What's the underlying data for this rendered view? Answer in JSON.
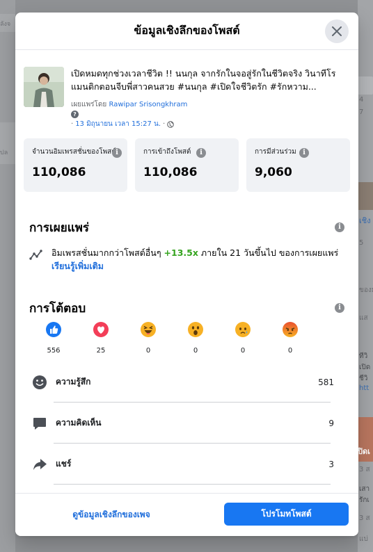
{
  "background": {
    "left_texts": [
      "ลังจ",
      "ปล"
    ],
    "right_texts": [
      "4",
      "7",
      "เชิง",
      "5",
      "ของม",
      "แส",
      "ทีวิ",
      "เปิด",
      "ชีวิ",
      "htt",
      "ปิดเ",
      "3 ส",
      "เสา",
      "รักเ",
      "3 ส",
      "แบ่"
    ]
  },
  "modal": {
    "title": "ข้อมูลเชิงลึกของโพสต์",
    "close_label": "ปิด"
  },
  "post": {
    "text": "เปิดหมดทุกช่วงเวลาชีวิต !! นนกุล จากรักในจอสู่รักในชีวิตจริง วินาทีโรแมนติกตอนจีบพี่สาวคนสวย #นนกุล #เปิดใจชีวิตรัก #รักหวาม...",
    "published_by_prefix": "เผยแพร่โดย",
    "author": "Rawipar Srisongkhram",
    "date": "13 มิถุนายน เวลา 15:27 น."
  },
  "stats": [
    {
      "label": "จำนวนอิมเพรสชั่นของโพสต์",
      "value": "110,086"
    },
    {
      "label": "การเข้าถึงโพสต์",
      "value": "110,086"
    },
    {
      "label": "การมีส่วนร่วม",
      "value": "9,060"
    }
  ],
  "distribution": {
    "title": "การเผยแพร่",
    "text_before": "อิมเพรสชั่นมากกว่าโพสต์อื่นๆ",
    "highlight": "+13.5x",
    "text_after": "ภายใน 21 วันขึ้นไป ของการเผยแพร่",
    "learn_more": "เรียนรู้เพิ่มเติม"
  },
  "responses": {
    "title": "การโต้ตอบ",
    "reactions": [
      {
        "name": "like",
        "count": "556",
        "color": "#1877f2"
      },
      {
        "name": "love",
        "count": "25",
        "color": "#f33e58"
      },
      {
        "name": "haha",
        "count": "0",
        "color": "#f7b125"
      },
      {
        "name": "wow",
        "count": "0",
        "color": "#f7b125"
      },
      {
        "name": "sad",
        "count": "0",
        "color": "#f7b125"
      },
      {
        "name": "angry",
        "count": "0",
        "color": "#e9710f"
      }
    ],
    "metrics": [
      {
        "label": "ความรู้สึก",
        "value": "581",
        "icon": "smiley-icon"
      },
      {
        "label": "ความคิดเห็น",
        "value": "9",
        "icon": "comment-icon"
      },
      {
        "label": "แชร์",
        "value": "3",
        "icon": "share-icon"
      }
    ]
  },
  "footer": {
    "page_insights_label": "ดูข้อมูลเชิงลึกของเพจ",
    "promote_label": "โปรโมทโพสต์"
  },
  "colors": {
    "accent": "#1877f2",
    "link": "#216fdb",
    "positive": "#36a420"
  }
}
